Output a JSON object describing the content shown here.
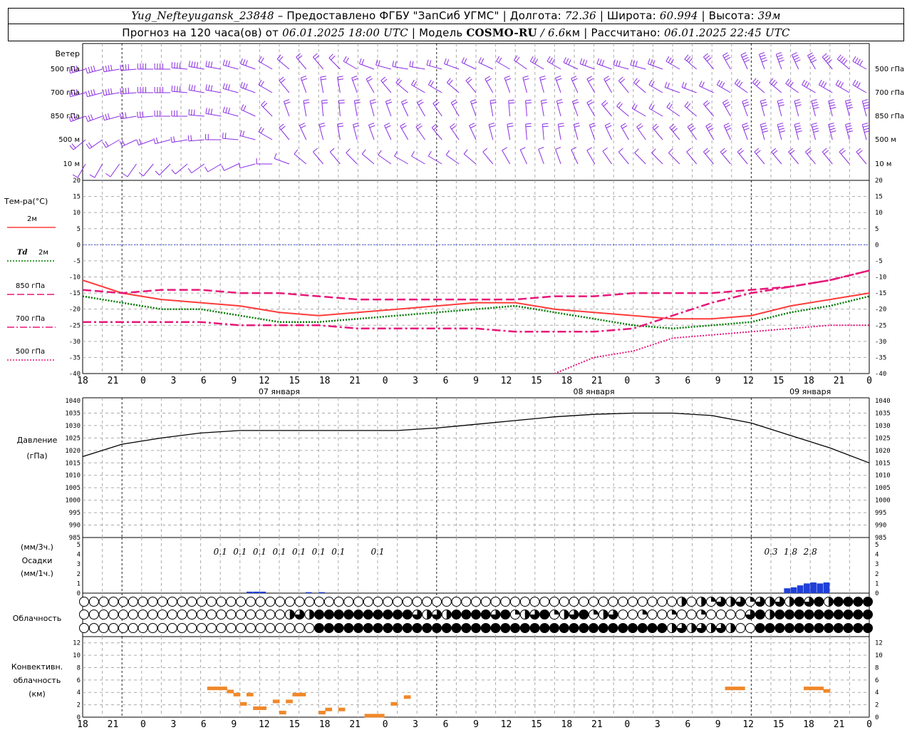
{
  "header": {
    "station": "Yug_Nefteyugansk_23848",
    "provider": "– Предоставлено ФГБУ \"ЗапСиб УГМС\"",
    "lon_label": "| Долгота:",
    "lon": "72.36",
    "lat_label": "| Широта:",
    "lat": "60.994",
    "alt_label": "| Высота:",
    "alt": "39м",
    "forecast_prefix": "Прогноз на 120 часа(ов) от",
    "forecast_time": "06.01.2025 18:00 UTC",
    "model_label": "| Модель",
    "model": "COSMO-RU",
    "resolution": "/ 6.6",
    "resolution_unit": "км",
    "computed_label": "| Рассчитано:",
    "computed_time": "06.01.2025 22:45 UTC"
  },
  "chart_data": {
    "time_axis": {
      "hour_ticks": [
        "18",
        "21",
        "0",
        "3",
        "6",
        "9",
        "12",
        "15",
        "18",
        "21",
        "0",
        "3",
        "6",
        "9",
        "12",
        "15",
        "18",
        "21",
        "0",
        "3",
        "6",
        "9",
        "12",
        "15",
        "18",
        "21",
        "0"
      ],
      "day_labels": [
        "07 января",
        "08 января",
        "09 января"
      ]
    },
    "wind": {
      "type": "barbs",
      "label": "Ветер",
      "levels": [
        "500 гПа",
        "700 гПа",
        "850 гПа",
        "500 м",
        "10 м"
      ]
    },
    "temperature": {
      "type": "line",
      "label": "Тем-ра(°C)",
      "ylim": [
        -40,
        20
      ],
      "yticks": [
        20,
        15,
        10,
        5,
        0,
        -5,
        -10,
        -15,
        -20,
        -25,
        -30,
        -35,
        -40
      ],
      "legend": [
        {
          "label": "2м",
          "color": "#ff3b3b",
          "style": "solid"
        },
        {
          "label": "Td",
          "label2": "2м",
          "color": "#007a00",
          "style": "dotted"
        },
        {
          "label": "850 гПа",
          "color": "#e8177a",
          "style": "long-dash"
        },
        {
          "label": "700 гПа",
          "color": "#e8177a",
          "style": "dash-dot"
        },
        {
          "label": "500 гПа",
          "color": "#e8177a",
          "style": "dotted"
        }
      ],
      "x_hours": [
        0,
        6,
        12,
        18,
        24,
        30,
        36,
        42,
        48,
        54,
        60,
        66,
        72,
        78,
        84,
        90,
        96,
        102,
        108,
        114,
        120
      ],
      "series": [
        {
          "name": "2м",
          "values": [
            -11,
            -15,
            -17,
            -18,
            -19,
            -21,
            -22,
            -21,
            -20,
            -19,
            -18,
            -18,
            -20,
            -21,
            -22,
            -23,
            -23,
            -22,
            -19,
            -17,
            -15
          ]
        },
        {
          "name": "Td 2м",
          "values": [
            -16,
            -18,
            -20,
            -20,
            -22,
            -24,
            -24,
            -23,
            -22,
            -21,
            -20,
            -19,
            -21,
            -23,
            -25,
            -26,
            -25,
            -24,
            -21,
            -19,
            -16
          ]
        },
        {
          "name": "850 гПа",
          "values": [
            -14,
            -15,
            -14,
            -14,
            -15,
            -15,
            -16,
            -17,
            -17,
            -17,
            -17,
            -17,
            -16,
            -16,
            -15,
            -15,
            -15,
            -14,
            -13,
            -11,
            -8
          ]
        },
        {
          "name": "700 гПа",
          "values": [
            -24,
            -24,
            -24,
            -24,
            -25,
            -25,
            -25,
            -26,
            -26,
            -26,
            -26,
            -27,
            -27,
            -27,
            -26,
            -22,
            -18,
            -15,
            -13,
            -11,
            -8
          ]
        },
        {
          "name": "500 гПа",
          "values": [
            null,
            null,
            null,
            null,
            null,
            null,
            null,
            null,
            null,
            null,
            null,
            null,
            -42,
            -35,
            -33,
            -29,
            -28,
            -27,
            -26,
            -25,
            -25
          ]
        }
      ]
    },
    "pressure": {
      "type": "line",
      "label": "Давление",
      "unit": "(гПа)",
      "ylim": [
        985,
        1040
      ],
      "yticks": [
        1040,
        1035,
        1030,
        1025,
        1020,
        1015,
        1010,
        1005,
        1000,
        995,
        990,
        985
      ],
      "x_hours": [
        0,
        6,
        12,
        18,
        24,
        30,
        36,
        42,
        48,
        54,
        60,
        66,
        72,
        78,
        84,
        90,
        96,
        102,
        108,
        114,
        120
      ],
      "values": [
        1017.5,
        1022.5,
        1025,
        1027,
        1028,
        1028,
        1028,
        1028,
        1028,
        1029,
        1030.5,
        1032,
        1033.5,
        1034.5,
        1035,
        1035,
        1034,
        1031,
        1026,
        1021,
        1015
      ]
    },
    "precipitation": {
      "type": "bar",
      "label": "Осадки",
      "unit_3h": "(мм/3ч.)",
      "unit_1h": "(мм/1ч.)",
      "ylim": [
        0,
        5
      ],
      "yticks": [
        5,
        4,
        3,
        2,
        1,
        0
      ],
      "totals_3h": [
        {
          "hour": 21,
          "text": "0.1"
        },
        {
          "hour": 24,
          "text": "0.1"
        },
        {
          "hour": 27,
          "text": "0.1"
        },
        {
          "hour": 30,
          "text": "0.1"
        },
        {
          "hour": 33,
          "text": "0.1"
        },
        {
          "hour": 36,
          "text": "0.1"
        },
        {
          "hour": 39,
          "text": "0.1"
        },
        {
          "hour": 45,
          "text": "0.1"
        },
        {
          "hour": 105,
          "text": "0.3"
        },
        {
          "hour": 108,
          "text": "1.8"
        },
        {
          "hour": 111,
          "text": "2.8"
        }
      ],
      "hourly_bars": [
        {
          "hour": 25,
          "value": 0.15
        },
        {
          "hour": 26,
          "value": 0.15
        },
        {
          "hour": 27,
          "value": 0.15
        },
        {
          "hour": 34,
          "value": 0.1
        },
        {
          "hour": 36,
          "value": 0.1
        },
        {
          "hour": 107,
          "value": 0.5
        },
        {
          "hour": 108,
          "value": 0.6
        },
        {
          "hour": 109,
          "value": 0.8
        },
        {
          "hour": 110,
          "value": 1.0
        },
        {
          "hour": 111,
          "value": 1.1
        },
        {
          "hour": 112,
          "value": 1.0
        },
        {
          "hour": 113,
          "value": 1.1
        }
      ]
    },
    "cloudiness": {
      "type": "table",
      "label": "Облачность",
      "rows": 3
    },
    "convective": {
      "type": "bar",
      "label": "Конвективн.",
      "label2": "облачность",
      "unit": "(км)",
      "ylim": [
        0,
        13
      ],
      "yticks": [
        12,
        10,
        8,
        6,
        4,
        2,
        0
      ],
      "segments": [
        {
          "hour": 19,
          "top": 4.7
        },
        {
          "hour": 20,
          "top": 4.7
        },
        {
          "hour": 21,
          "top": 4.7
        },
        {
          "hour": 22,
          "top": 4.2
        },
        {
          "hour": 23,
          "top": 3.7
        },
        {
          "hour": 24,
          "top": 2.2
        },
        {
          "hour": 25,
          "top": 3.7
        },
        {
          "hour": 26,
          "top": 1.5
        },
        {
          "hour": 27,
          "top": 1.5
        },
        {
          "hour": 29,
          "top": 2.6
        },
        {
          "hour": 30,
          "top": 0.8
        },
        {
          "hour": 31,
          "top": 2.6
        },
        {
          "hour": 32,
          "top": 3.7
        },
        {
          "hour": 33,
          "top": 3.7
        },
        {
          "hour": 36,
          "top": 0.8
        },
        {
          "hour": 37,
          "top": 1.3
        },
        {
          "hour": 39,
          "top": 1.3
        },
        {
          "hour": 43,
          "top": 0.3
        },
        {
          "hour": 44,
          "top": 0.3
        },
        {
          "hour": 45,
          "top": 0.3
        },
        {
          "hour": 47,
          "top": 2.2
        },
        {
          "hour": 49,
          "top": 3.3
        },
        {
          "hour": 98,
          "top": 4.7
        },
        {
          "hour": 99,
          "top": 4.7
        },
        {
          "hour": 100,
          "top": 4.7
        },
        {
          "hour": 110,
          "top": 4.7
        },
        {
          "hour": 111,
          "top": 4.7
        },
        {
          "hour": 112,
          "top": 4.7
        },
        {
          "hour": 113,
          "top": 4.3
        }
      ]
    }
  }
}
